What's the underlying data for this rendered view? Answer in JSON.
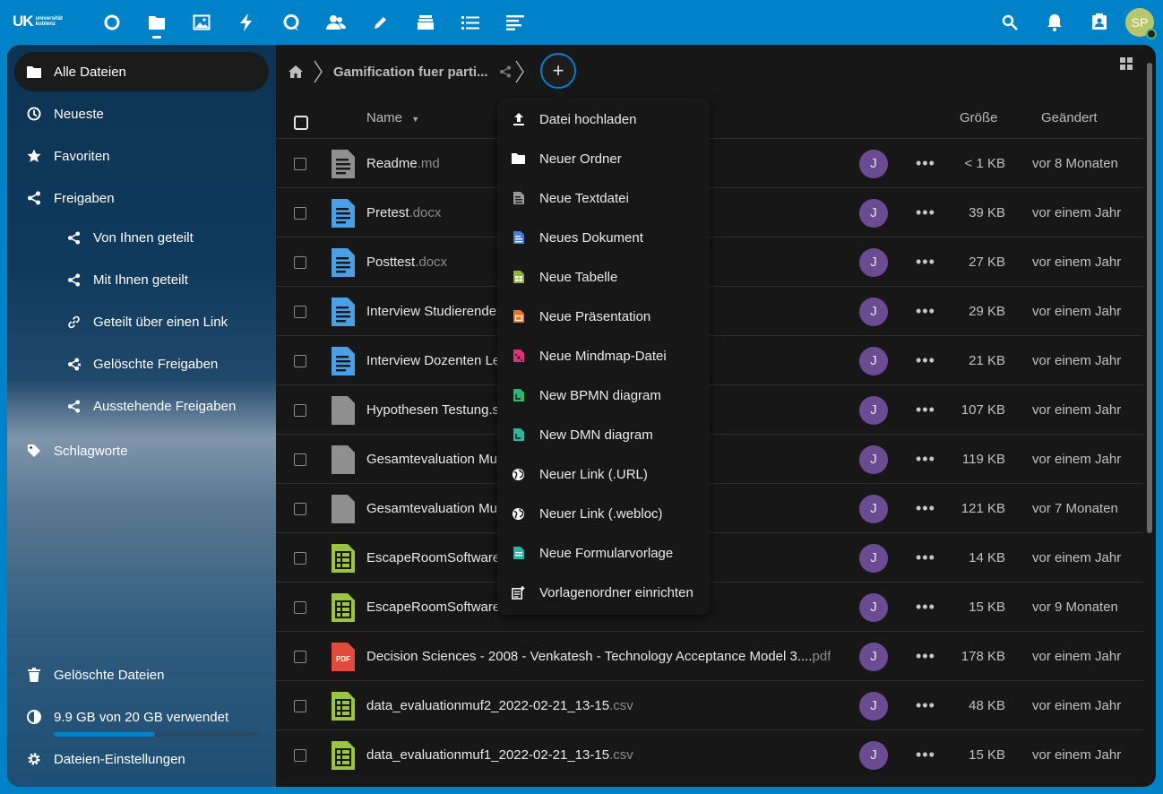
{
  "topbar": {
    "logo_main": "UK",
    "logo_sub1": "universität",
    "logo_sub2": "koblenz",
    "apps": [
      "dashboard",
      "files",
      "photos",
      "activity",
      "search-app",
      "contacts",
      "notes",
      "deck",
      "tasks",
      "forms"
    ],
    "avatar_initials": "SP"
  },
  "sidebar": {
    "items": [
      {
        "label": "Alle Dateien",
        "icon": "folder-icon"
      },
      {
        "label": "Neueste",
        "icon": "clock-icon"
      },
      {
        "label": "Favoriten",
        "icon": "star-icon"
      },
      {
        "label": "Freigaben",
        "icon": "share-icon"
      },
      {
        "label": "Von Ihnen geteilt",
        "icon": "share-icon"
      },
      {
        "label": "Mit Ihnen geteilt",
        "icon": "share-icon"
      },
      {
        "label": "Geteilt über einen Link",
        "icon": "link-icon"
      },
      {
        "label": "Gelöschte Freigaben",
        "icon": "share-deleted-icon"
      },
      {
        "label": "Ausstehende Freigaben",
        "icon": "share-icon"
      },
      {
        "label": "Schlagworte",
        "icon": "tag-icon"
      }
    ],
    "trash_label": "Gelöschte Dateien",
    "quota_label": "9.9 GB von 20 GB verwendet",
    "quota_fraction": 0.495,
    "settings_label": "Dateien-Einstellungen"
  },
  "breadcrumb": {
    "folder": "Gamification fuer parti..."
  },
  "table": {
    "col_name": "Name",
    "col_size": "Größe",
    "col_modified": "Geändert",
    "rows": [
      {
        "name": "Readme",
        "ext": ".md",
        "type": "text",
        "share": "J",
        "size": "< 1 KB",
        "modified": "vor 8 Monaten"
      },
      {
        "name": "Pretest",
        "ext": ".docx",
        "type": "doc",
        "share": "J",
        "size": "39 KB",
        "modified": "vor einem Jahr"
      },
      {
        "name": "Posttest",
        "ext": ".docx",
        "type": "doc",
        "share": "J",
        "size": "27 KB",
        "modified": "vor einem Jahr"
      },
      {
        "name": "Interview Studierende",
        "ext": "",
        "type": "doc",
        "share": "J",
        "size": "29 KB",
        "modified": "vor einem Jahr"
      },
      {
        "name": "Interview Dozenten Le",
        "ext": "",
        "type": "doc",
        "share": "J",
        "size": "21 KB",
        "modified": "vor einem Jahr"
      },
      {
        "name": "Hypothesen Testung.s",
        "ext": "",
        "type": "file",
        "share": "J",
        "size": "107 KB",
        "modified": "vor einem Jahr"
      },
      {
        "name": "Gesamtevaluation Mu",
        "ext": "",
        "type": "file",
        "share": "J",
        "size": "119 KB",
        "modified": "vor einem Jahr"
      },
      {
        "name": "Gesamtevaluation Mu",
        "ext": "",
        "type": "file",
        "share": "J",
        "size": "121 KB",
        "modified": "vor 7 Monaten"
      },
      {
        "name": "EscapeRoomSoftware",
        "ext": "",
        "type": "sheet",
        "share": "J",
        "size": "14 KB",
        "modified": "vor einem Jahr"
      },
      {
        "name": "EscapeRoomSoftware.",
        "ext": "",
        "type": "sheet",
        "share": "J",
        "size": "15 KB",
        "modified": "vor 9 Monaten"
      },
      {
        "name": "Decision Sciences - 2008 - Venkatesh - Technology Acceptance Model 3....",
        "ext": "pdf",
        "type": "pdf",
        "share": "J",
        "size": "178 KB",
        "modified": "vor einem Jahr"
      },
      {
        "name": "data_evaluationmuf2_2022-02-21_13-15",
        "ext": ".csv",
        "type": "sheet",
        "share": "J",
        "size": "48 KB",
        "modified": "vor einem Jahr"
      },
      {
        "name": "data_evaluationmuf1_2022-02-21_13-15",
        "ext": ".csv",
        "type": "sheet",
        "share": "J",
        "size": "15 KB",
        "modified": "vor einem Jahr"
      }
    ]
  },
  "new_menu": {
    "items": [
      {
        "label": "Datei hochladen",
        "icon": "upload-icon"
      },
      {
        "label": "Neuer Ordner",
        "icon": "folder-icon"
      },
      {
        "label": "Neue Textdatei",
        "icon": "text-file-icon"
      },
      {
        "label": "Neues Dokument",
        "icon": "document-icon"
      },
      {
        "label": "Neue Tabelle",
        "icon": "spreadsheet-icon"
      },
      {
        "label": "Neue Präsentation",
        "icon": "presentation-icon"
      },
      {
        "label": "Neue Mindmap-Datei",
        "icon": "mindmap-icon"
      },
      {
        "label": "New BPMN diagram",
        "icon": "bpmn-icon"
      },
      {
        "label": "New DMN diagram",
        "icon": "dmn-icon"
      },
      {
        "label": "Neuer Link (.URL)",
        "icon": "globe-icon"
      },
      {
        "label": "Neuer Link (.webloc)",
        "icon": "globe-icon"
      },
      {
        "label": "Neue Formularvorlage",
        "icon": "form-template-icon"
      },
      {
        "label": "Vorlagenordner einrichten",
        "icon": "template-folder-icon"
      }
    ]
  },
  "colors": {
    "brand": "#0082c9",
    "doc": "#4b9fe4",
    "sheet": "#9bc43f",
    "pdf": "#e04b3d",
    "avatar_share": "#6b4c93"
  }
}
